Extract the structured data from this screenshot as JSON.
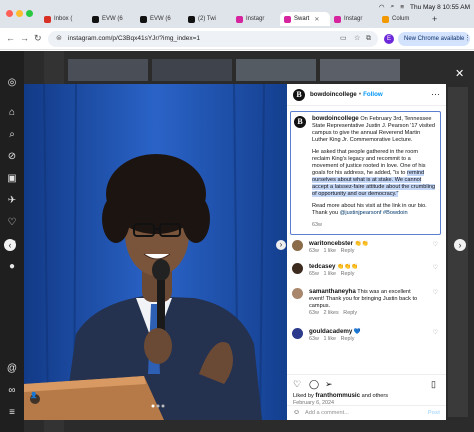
{
  "tabs": [
    {
      "label": "Inbox (",
      "color": "#d93025"
    },
    {
      "label": "EVW (6",
      "color": "#111111"
    },
    {
      "label": "EVW (6",
      "color": "#111111"
    },
    {
      "label": "(2) Twi",
      "color": "#111111"
    },
    {
      "label": "Instagr",
      "color": "#d6249f"
    },
    {
      "label": "Swart",
      "color": "#d6249f",
      "active": true
    },
    {
      "label": "Instagr",
      "color": "#d6249f"
    },
    {
      "label": "Colum",
      "color": "#f29900"
    }
  ],
  "status": {
    "datetime": "Thu May 8  10:55 AM"
  },
  "toolbar": {
    "url": "instagram.com/p/C3Bqx41sYJr/?img_index=1",
    "new_chrome_label": "New Chrome available",
    "profile_letter": "E"
  },
  "post": {
    "account": "bowdoincollege",
    "follow_label": "Follow",
    "logo_letter": "B",
    "caption_user": "bowdoincollege",
    "caption_p1": "On February 3rd, Tennessee State Representative Justin J. Pearson '17 visited campus to give the annual Reverend Martin Luther King Jr. Commemorative Lecture.",
    "caption_p2_plain": "He asked that people gathered in the room reclaim King's legacy and recommit to a movement of justice rooted in love. One of his goals for his address, he added, \"is to ",
    "caption_p2_highlight": "remind ourselves about what is at stake. We cannot accept a laissez-faire attitude about the crumbling of opportunity and our democracy.\"",
    "caption_p3_plain": "Read more about his visit at the link in our bio. Thank you ",
    "caption_p3_link": "@justinjpearsonf #Bowdoin",
    "caption_age": "63w",
    "comments": [
      {
        "user": "waritoncebster",
        "text": "👏👏",
        "age": "63w",
        "likes": "1 like",
        "reply": "Reply",
        "avatar": "#8b6b4a"
      },
      {
        "user": "tedcasey",
        "text": "👏👏👏",
        "age": "65w",
        "likes": "1 like",
        "reply": "Reply",
        "avatar": "#3d2b1f"
      },
      {
        "user": "samanthaneyha",
        "text": "This was an excellent event! Thank you for bringing Justin back to campus.",
        "age": "63w",
        "likes": "2 likes",
        "reply": "Reply",
        "avatar": "#a9876c"
      },
      {
        "user": "gouldacademy",
        "text": "💙",
        "age": "63w",
        "likes": "1 like",
        "reply": "Reply",
        "avatar": "#2b3a8a"
      }
    ],
    "liked_by_prefix": "Liked by ",
    "liked_by_user": "franthommusic",
    "liked_by_suffix": " and others",
    "date": "February 6, 2024",
    "add_comment_placeholder": "Add a comment...",
    "post_label": "Post"
  }
}
